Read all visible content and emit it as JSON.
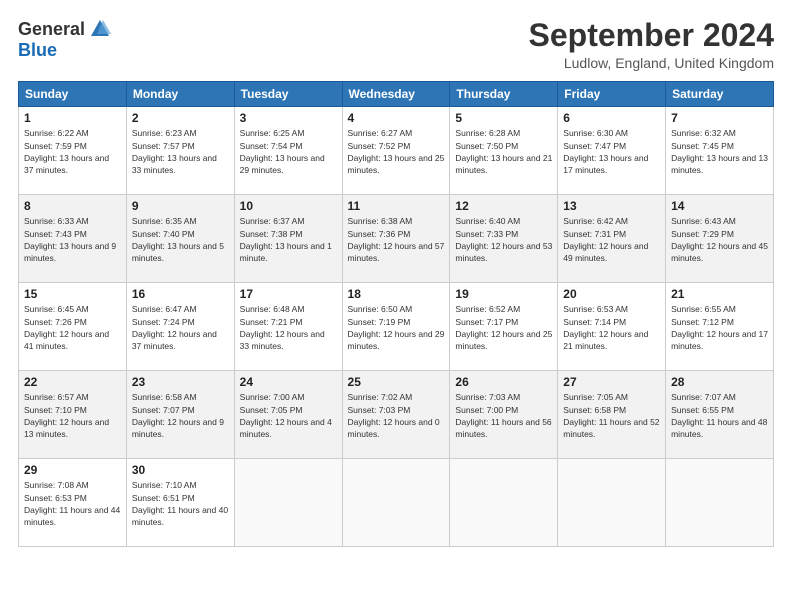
{
  "logo": {
    "general": "General",
    "blue": "Blue"
  },
  "header": {
    "month": "September 2024",
    "location": "Ludlow, England, United Kingdom"
  },
  "weekdays": [
    "Sunday",
    "Monday",
    "Tuesday",
    "Wednesday",
    "Thursday",
    "Friday",
    "Saturday"
  ],
  "weeks": [
    [
      {
        "day": "1",
        "sunrise": "6:22 AM",
        "sunset": "7:59 PM",
        "daylight": "13 hours and 37 minutes."
      },
      {
        "day": "2",
        "sunrise": "6:23 AM",
        "sunset": "7:57 PM",
        "daylight": "13 hours and 33 minutes."
      },
      {
        "day": "3",
        "sunrise": "6:25 AM",
        "sunset": "7:54 PM",
        "daylight": "13 hours and 29 minutes."
      },
      {
        "day": "4",
        "sunrise": "6:27 AM",
        "sunset": "7:52 PM",
        "daylight": "13 hours and 25 minutes."
      },
      {
        "day": "5",
        "sunrise": "6:28 AM",
        "sunset": "7:50 PM",
        "daylight": "13 hours and 21 minutes."
      },
      {
        "day": "6",
        "sunrise": "6:30 AM",
        "sunset": "7:47 PM",
        "daylight": "13 hours and 17 minutes."
      },
      {
        "day": "7",
        "sunrise": "6:32 AM",
        "sunset": "7:45 PM",
        "daylight": "13 hours and 13 minutes."
      }
    ],
    [
      {
        "day": "8",
        "sunrise": "6:33 AM",
        "sunset": "7:43 PM",
        "daylight": "13 hours and 9 minutes."
      },
      {
        "day": "9",
        "sunrise": "6:35 AM",
        "sunset": "7:40 PM",
        "daylight": "13 hours and 5 minutes."
      },
      {
        "day": "10",
        "sunrise": "6:37 AM",
        "sunset": "7:38 PM",
        "daylight": "13 hours and 1 minute."
      },
      {
        "day": "11",
        "sunrise": "6:38 AM",
        "sunset": "7:36 PM",
        "daylight": "12 hours and 57 minutes."
      },
      {
        "day": "12",
        "sunrise": "6:40 AM",
        "sunset": "7:33 PM",
        "daylight": "12 hours and 53 minutes."
      },
      {
        "day": "13",
        "sunrise": "6:42 AM",
        "sunset": "7:31 PM",
        "daylight": "12 hours and 49 minutes."
      },
      {
        "day": "14",
        "sunrise": "6:43 AM",
        "sunset": "7:29 PM",
        "daylight": "12 hours and 45 minutes."
      }
    ],
    [
      {
        "day": "15",
        "sunrise": "6:45 AM",
        "sunset": "7:26 PM",
        "daylight": "12 hours and 41 minutes."
      },
      {
        "day": "16",
        "sunrise": "6:47 AM",
        "sunset": "7:24 PM",
        "daylight": "12 hours and 37 minutes."
      },
      {
        "day": "17",
        "sunrise": "6:48 AM",
        "sunset": "7:21 PM",
        "daylight": "12 hours and 33 minutes."
      },
      {
        "day": "18",
        "sunrise": "6:50 AM",
        "sunset": "7:19 PM",
        "daylight": "12 hours and 29 minutes."
      },
      {
        "day": "19",
        "sunrise": "6:52 AM",
        "sunset": "7:17 PM",
        "daylight": "12 hours and 25 minutes."
      },
      {
        "day": "20",
        "sunrise": "6:53 AM",
        "sunset": "7:14 PM",
        "daylight": "12 hours and 21 minutes."
      },
      {
        "day": "21",
        "sunrise": "6:55 AM",
        "sunset": "7:12 PM",
        "daylight": "12 hours and 17 minutes."
      }
    ],
    [
      {
        "day": "22",
        "sunrise": "6:57 AM",
        "sunset": "7:10 PM",
        "daylight": "12 hours and 13 minutes."
      },
      {
        "day": "23",
        "sunrise": "6:58 AM",
        "sunset": "7:07 PM",
        "daylight": "12 hours and 9 minutes."
      },
      {
        "day": "24",
        "sunrise": "7:00 AM",
        "sunset": "7:05 PM",
        "daylight": "12 hours and 4 minutes."
      },
      {
        "day": "25",
        "sunrise": "7:02 AM",
        "sunset": "7:03 PM",
        "daylight": "12 hours and 0 minutes."
      },
      {
        "day": "26",
        "sunrise": "7:03 AM",
        "sunset": "7:00 PM",
        "daylight": "11 hours and 56 minutes."
      },
      {
        "day": "27",
        "sunrise": "7:05 AM",
        "sunset": "6:58 PM",
        "daylight": "11 hours and 52 minutes."
      },
      {
        "day": "28",
        "sunrise": "7:07 AM",
        "sunset": "6:55 PM",
        "daylight": "11 hours and 48 minutes."
      }
    ],
    [
      {
        "day": "29",
        "sunrise": "7:08 AM",
        "sunset": "6:53 PM",
        "daylight": "11 hours and 44 minutes."
      },
      {
        "day": "30",
        "sunrise": "7:10 AM",
        "sunset": "6:51 PM",
        "daylight": "11 hours and 40 minutes."
      },
      null,
      null,
      null,
      null,
      null
    ]
  ]
}
